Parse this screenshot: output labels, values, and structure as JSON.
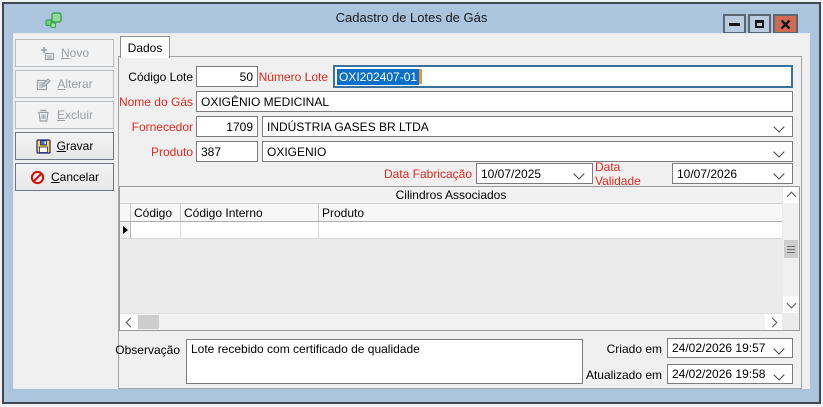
{
  "window": {
    "title": "Cadastro de Lotes de Gás",
    "controls": [
      {
        "name": "minimize"
      },
      {
        "name": "maximize"
      },
      {
        "name": "close"
      }
    ]
  },
  "sidebar": {
    "buttons": [
      {
        "key": "N",
        "rest": "ovo",
        "enabled": false,
        "icon": "new-record-icon"
      },
      {
        "key": "A",
        "rest": "lterar",
        "enabled": false,
        "icon": "edit-record-icon"
      },
      {
        "key": "E",
        "rest": "xcluir",
        "enabled": false,
        "icon": "delete-record-icon"
      },
      {
        "key": "G",
        "rest": "ravar",
        "enabled": true,
        "icon": "save-icon"
      },
      {
        "key": "C",
        "rest": "ancelar",
        "enabled": true,
        "icon": "cancel-icon"
      }
    ]
  },
  "tabs": [
    {
      "label": "Dados",
      "active": true
    }
  ],
  "form": {
    "codigo_lote": {
      "label": "Código Lote",
      "value": "50"
    },
    "numero_lote": {
      "label": "Número Lote",
      "value": "OXI202407-01",
      "selected": true
    },
    "nome_gas": {
      "label": "Nome do Gás",
      "value": "OXIGÊNIO MEDICINAL"
    },
    "fornecedor": {
      "label": "Fornecedor",
      "code": "1709",
      "value": "INDÚSTRIA GASES BR LTDA"
    },
    "produto": {
      "label": "Produto",
      "code": "387",
      "value": "OXIGENIO"
    },
    "data_fabricacao": {
      "label": "Data Fabricação",
      "value": "10/07/2025"
    },
    "data_validade": {
      "label": "Data Validade",
      "value": "10/07/2026"
    },
    "observacao": {
      "label": "Observação",
      "value": "Lote recebido com certificado de qualidade"
    },
    "criado_em": {
      "label": "Criado em",
      "value": "24/02/2026 19:57"
    },
    "atualizado_em": {
      "label": "Atualizado em",
      "value": "24/02/2026 19:58"
    }
  },
  "grid": {
    "band_title": "Cilindros Associados",
    "columns": [
      "Código",
      "Código Interno",
      "Produto"
    ],
    "rows": [
      [
        "",
        "",
        ""
      ]
    ]
  },
  "colors": {
    "titlebar_blue": "#abc5df",
    "frame_dark": "#41474e",
    "label_red": "#e02a1e",
    "selection_blue": "#0c6fc9",
    "focus_border_blue": "#39719e",
    "close_button_red": "#d06a54",
    "client_gray": "#f0f0f0"
  }
}
